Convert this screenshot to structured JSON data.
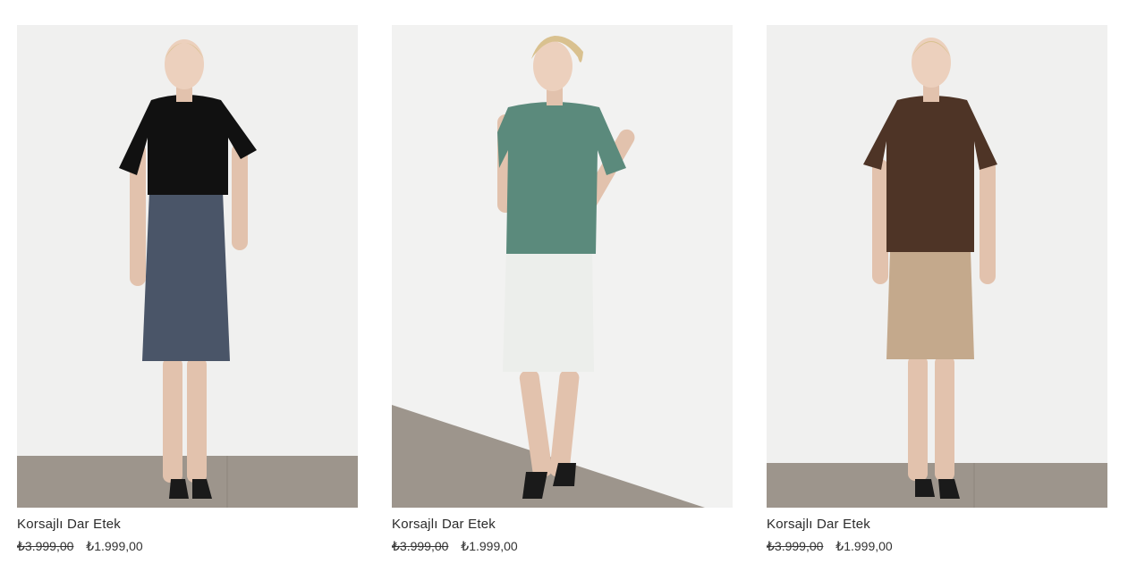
{
  "products": [
    {
      "title": "Korsajlı Dar Etek",
      "old_price": "₺3.999,00",
      "new_price": "₺1.999,00",
      "top_color": "#111111",
      "skirt_color": "#4a5568"
    },
    {
      "title": "Korsajlı Dar Etek",
      "old_price": "₺3.999,00",
      "new_price": "₺1.999,00",
      "top_color": "#5b8a7c",
      "skirt_color": "#eceeeb"
    },
    {
      "title": "Korsajlı Dar Etek",
      "old_price": "₺3.999,00",
      "new_price": "₺1.999,00",
      "top_color": "#4e3426",
      "skirt_color": "#c4a98c"
    }
  ]
}
